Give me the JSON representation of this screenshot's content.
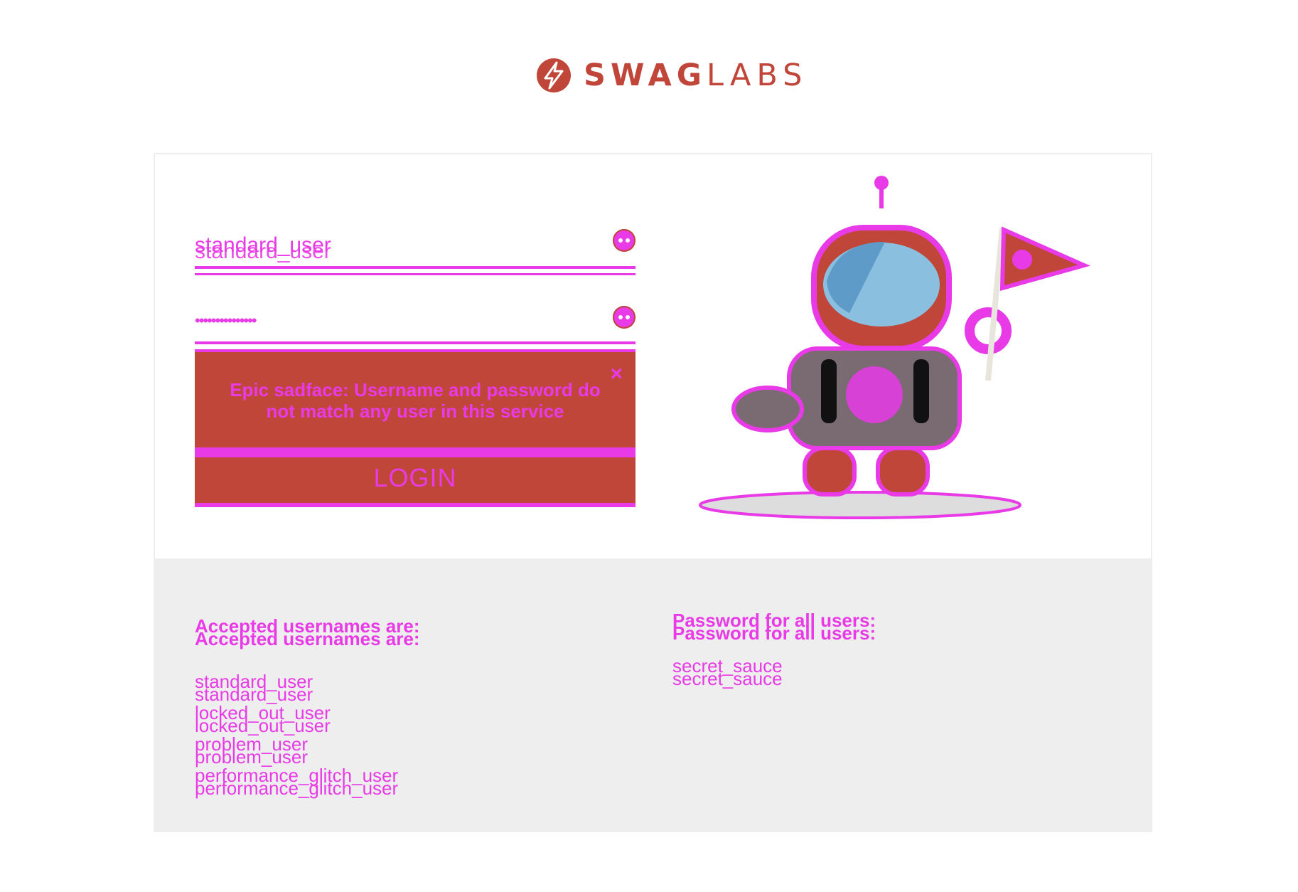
{
  "brand": {
    "logo_bold": "SWAG",
    "logo_light": "LABS",
    "color": "#c0463a"
  },
  "login": {
    "username_value": "standard_user",
    "password_mask": "•••••••••••••••",
    "error_message": "Epic sadface: Username and password do not match any user in this service",
    "error_message_small": "Username and password do not match any user in this service",
    "login_label": "LOGIN"
  },
  "credentials": {
    "usernames_heading": "Accepted usernames are:",
    "usernames": [
      "standard_user",
      "locked_out_user",
      "problem_user",
      "performance_glitch_user"
    ],
    "password_heading": "Password for all users:",
    "password": "secret_sauce"
  },
  "icons": {
    "logo": "swag-labs-bolt-icon",
    "field_error": "error-circle-icon",
    "close": "close-icon",
    "mascot": "robot-mascot-icon"
  },
  "colors": {
    "highlight": "#e83ae6",
    "panel_bg": "#eeeeee"
  }
}
